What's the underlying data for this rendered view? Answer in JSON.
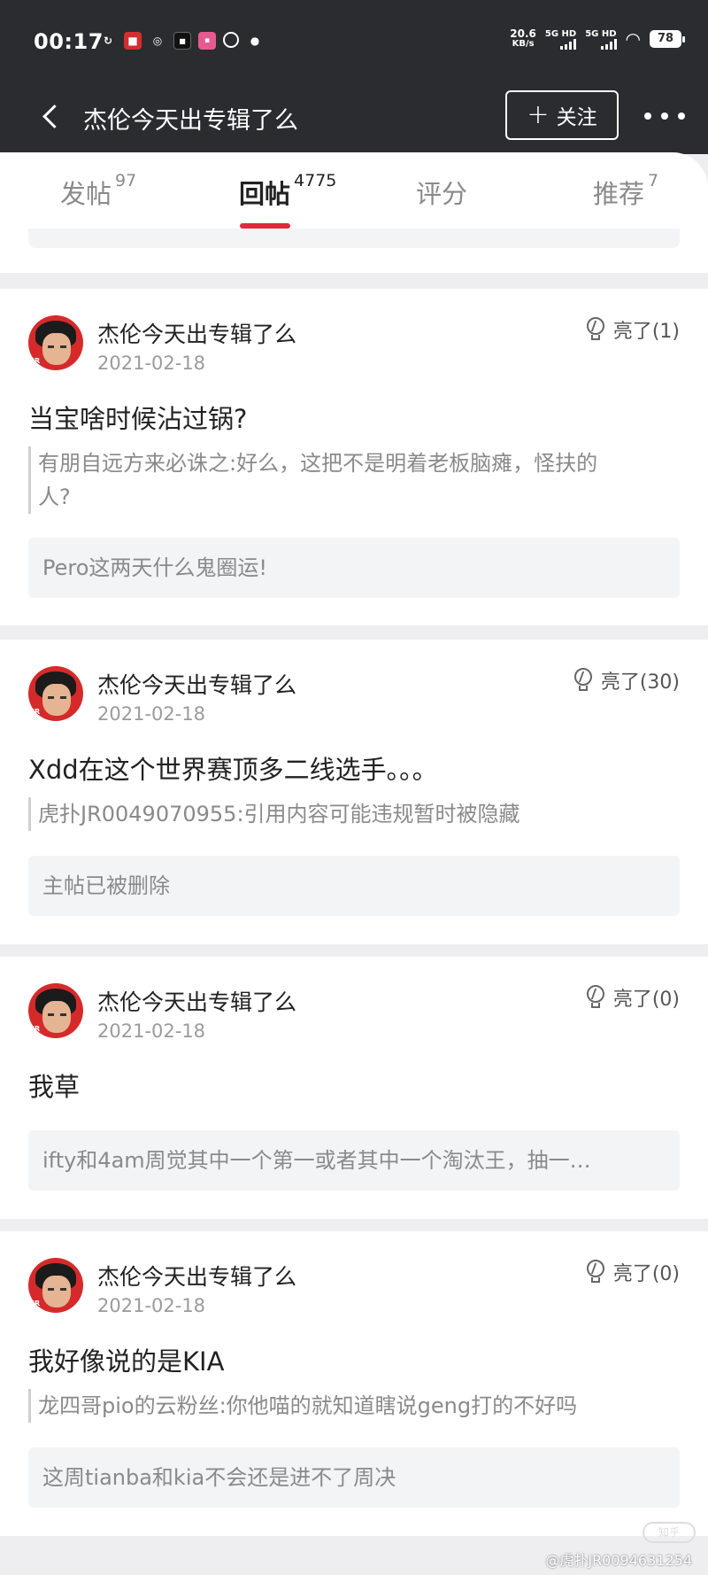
{
  "status_bar": {
    "time": "00:17",
    "speed_value": "20.6",
    "speed_unit": "KB/s",
    "net1": "5G HD",
    "net2": "5G HD",
    "battery": "78"
  },
  "nav": {
    "title": "杰伦今天出专辑了么",
    "follow_label": "关注"
  },
  "tabs": [
    {
      "label": "发帖",
      "count": "97"
    },
    {
      "label": "回帖",
      "count": "4775"
    },
    {
      "label": "评分",
      "count": ""
    },
    {
      "label": "推荐",
      "count": "7"
    }
  ],
  "replies": [
    {
      "username": "杰伦今天出专辑了么",
      "date": "2021-02-18",
      "light": "亮了(1)",
      "content": "当宝啥时候沾过锅?",
      "quote_line1": "有朋自远方来必诛之:好么，这把不是明着老板脑瘫，怪扶的",
      "quote_line2": "人?",
      "source": "Pero这两天什么鬼圈运!"
    },
    {
      "username": "杰伦今天出专辑了么",
      "date": "2021-02-18",
      "light": "亮了(30)",
      "content": "Xdd在这个世界赛顶多二线选手。。。",
      "quote_line1": "虎扑JR0049070955:引用内容可能违规暂时被隐藏",
      "source": "主帖已被删除"
    },
    {
      "username": "杰伦今天出专辑了么",
      "date": "2021-02-18",
      "light": "亮了(0)",
      "content": "我草",
      "source": "ifty和4am周觉其中一个第一或者其中一个淘汰王，抽一…"
    },
    {
      "username": "杰伦今天出专辑了么",
      "date": "2021-02-18",
      "light": "亮了(0)",
      "content": "我好像说的是KIA",
      "quote_line1": "龙四哥pio的云粉丝:你他喵的就知道瞎说geng打的不好吗",
      "source": "这周tianba和kia不会还是进不了周决"
    }
  ],
  "watermark": "@虎扑JR0094631254",
  "watermark_logo": "知乎"
}
